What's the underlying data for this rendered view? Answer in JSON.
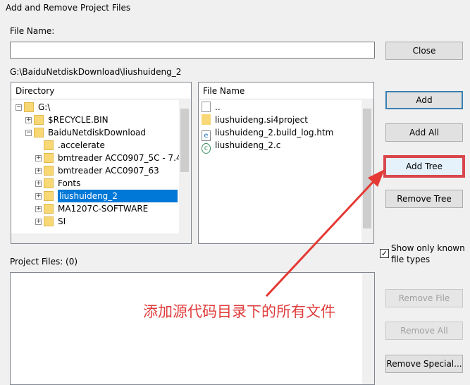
{
  "window": {
    "title": "Add and Remove Project Files"
  },
  "file_name": {
    "label": "File Name:",
    "value": ""
  },
  "current_path": "G:\\BaiduNetdiskDownload\\liushuideng_2",
  "directory": {
    "header": "Directory",
    "items": [
      {
        "label": "G:\\",
        "expander": "minus"
      },
      {
        "label": "$RECYCLE.BIN",
        "expander": "plus"
      },
      {
        "label": "BaiduNetdiskDownload",
        "expander": "minus"
      },
      {
        "label": ".accelerate",
        "expander": "none"
      },
      {
        "label": "bmtreader ACC0907_5C - 7.4",
        "expander": "plus"
      },
      {
        "label": "bmtreader ACC0907_63",
        "expander": "plus"
      },
      {
        "label": "Fonts",
        "expander": "plus"
      },
      {
        "label": "liushuideng_2",
        "expander": "plus",
        "selected": true
      },
      {
        "label": "MA1207C-SOFTWARE",
        "expander": "plus"
      },
      {
        "label": "SI",
        "expander": "plus"
      }
    ]
  },
  "files": {
    "header": "File Name",
    "items": [
      {
        "label": "..",
        "icon": "file-icon"
      },
      {
        "label": "liushuideng.si4project",
        "icon": "folder-icon"
      },
      {
        "label": "liushuideng_2.build_log.htm",
        "icon": "html-file-icon"
      },
      {
        "label": "liushuideng_2.c",
        "icon": "c-file-icon"
      }
    ]
  },
  "buttons": {
    "close": "Close",
    "add": "Add",
    "add_all": "Add All",
    "add_tree": "Add Tree",
    "remove_tree": "Remove Tree",
    "remove_file": "Remove File",
    "remove_all": "Remove All",
    "remove_special": "Remove Special..."
  },
  "show_known": {
    "label": "Show only known file types",
    "checked": true
  },
  "project_files": {
    "label": "Project Files: (0)"
  },
  "annotation": {
    "text": "添加源代码目录下的所有文件",
    "color": "#e03c3c"
  }
}
